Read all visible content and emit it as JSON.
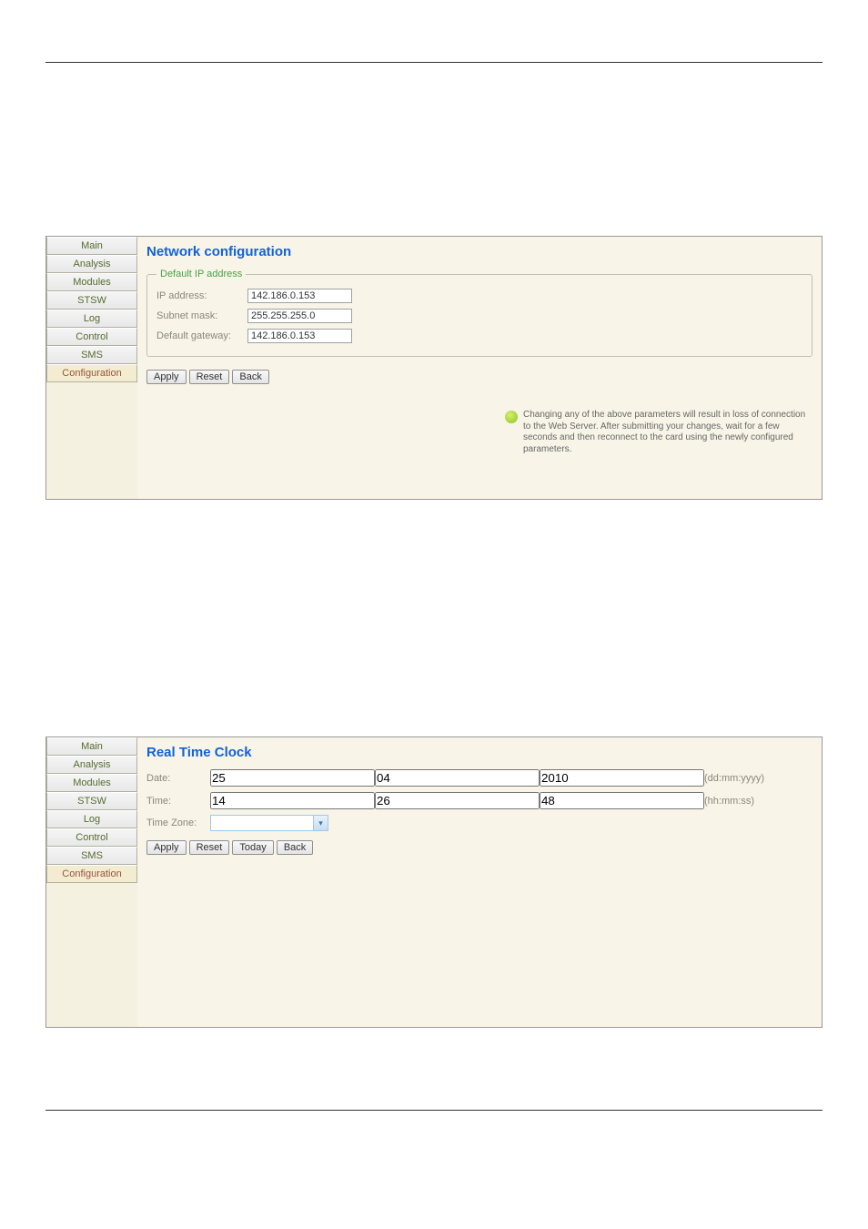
{
  "sidebar": {
    "items": [
      {
        "label": "Main"
      },
      {
        "label": "Analysis"
      },
      {
        "label": "Modules"
      },
      {
        "label": "STSW"
      },
      {
        "label": "Log"
      },
      {
        "label": "Control"
      },
      {
        "label": "SMS"
      },
      {
        "label": "Configuration"
      }
    ]
  },
  "network": {
    "title": "Network configuration",
    "legend": "Default IP address",
    "ip_label": "IP address:",
    "ip_value": "142.186.0.153",
    "subnet_label": "Subnet mask:",
    "subnet_value": "255.255.255.0",
    "gateway_label": "Default gateway:",
    "gateway_value": "142.186.0.153",
    "apply": "Apply",
    "reset": "Reset",
    "back": "Back",
    "info": "Changing any of the above parameters will result in loss of connection to the Web Server. After submitting your changes, wait for a few seconds and then reconnect to the card using the newly configured parameters."
  },
  "rtc": {
    "title": "Real Time Clock",
    "date_label": "Date:",
    "date_dd": "25",
    "date_mm": "04",
    "date_yyyy": "2010",
    "date_hint": "(dd:mm:yyyy)",
    "time_label": "Time:",
    "time_hh": "14",
    "time_mm": "26",
    "time_ss": "48",
    "time_hint": "(hh:mm:ss)",
    "tz_label": "Time Zone:",
    "apply": "Apply",
    "reset": "Reset",
    "today": "Today",
    "back": "Back"
  }
}
